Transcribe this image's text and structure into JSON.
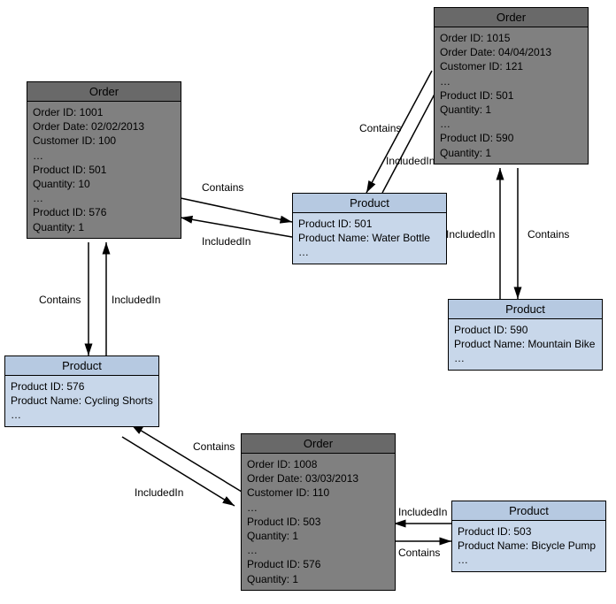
{
  "types": {
    "order_title": "Order",
    "product_title": "Product"
  },
  "labels": {
    "contains": "Contains",
    "includedIn": "IncludedIn"
  },
  "orders": {
    "o1001": {
      "lines": "Order ID: 1001\nOrder Date: 02/02/2013\nCustomer ID: 100\n…\nProduct ID: 501\nQuantity: 10\n…\nProduct ID: 576\nQuantity: 1"
    },
    "o1015": {
      "lines": "Order ID: 1015\nOrder Date: 04/04/2013\nCustomer ID: 121\n…\nProduct ID: 501\nQuantity: 1\n…\nProduct ID: 590\nQuantity: 1"
    },
    "o1008": {
      "lines": "Order ID: 1008\nOrder Date: 03/03/2013\nCustomer ID: 110\n…\nProduct ID: 503\nQuantity: 1\n…\nProduct ID: 576\nQuantity: 1"
    }
  },
  "products": {
    "p501": {
      "lines": "Product ID: 501\nProduct Name: Water Bottle\n…"
    },
    "p576": {
      "lines": "Product ID: 576\nProduct Name: Cycling Shorts\n…"
    },
    "p590": {
      "lines": "Product ID: 590\nProduct Name: Mountain Bike\n…"
    },
    "p503": {
      "lines": "Product ID: 503\nProduct Name: Bicycle Pump\n…"
    }
  },
  "chart_data": {
    "type": "table",
    "title": "Order–Product relationship graph",
    "nodes": [
      {
        "id": "o1001",
        "type": "Order",
        "order_id": 1001,
        "order_date": "02/02/2013",
        "customer_id": 100,
        "items": [
          {
            "product_id": 501,
            "quantity": 10
          },
          {
            "product_id": 576,
            "quantity": 1
          }
        ]
      },
      {
        "id": "o1015",
        "type": "Order",
        "order_id": 1015,
        "order_date": "04/04/2013",
        "customer_id": 121,
        "items": [
          {
            "product_id": 501,
            "quantity": 1
          },
          {
            "product_id": 590,
            "quantity": 1
          }
        ]
      },
      {
        "id": "o1008",
        "type": "Order",
        "order_id": 1008,
        "order_date": "03/03/2013",
        "customer_id": 110,
        "items": [
          {
            "product_id": 503,
            "quantity": 1
          },
          {
            "product_id": 576,
            "quantity": 1
          }
        ]
      },
      {
        "id": "p501",
        "type": "Product",
        "product_id": 501,
        "product_name": "Water Bottle"
      },
      {
        "id": "p576",
        "type": "Product",
        "product_id": 576,
        "product_name": "Cycling Shorts"
      },
      {
        "id": "p590",
        "type": "Product",
        "product_id": 590,
        "product_name": "Mountain Bike"
      },
      {
        "id": "p503",
        "type": "Product",
        "product_id": 503,
        "product_name": "Bicycle Pump"
      }
    ],
    "edges": [
      {
        "from": "o1001",
        "to": "p501",
        "label": "Contains"
      },
      {
        "from": "p501",
        "to": "o1001",
        "label": "IncludedIn"
      },
      {
        "from": "o1001",
        "to": "p576",
        "label": "Contains"
      },
      {
        "from": "p576",
        "to": "o1001",
        "label": "IncludedIn"
      },
      {
        "from": "o1015",
        "to": "p501",
        "label": "Contains"
      },
      {
        "from": "p501",
        "to": "o1015",
        "label": "IncludedIn"
      },
      {
        "from": "o1015",
        "to": "p590",
        "label": "Contains"
      },
      {
        "from": "p590",
        "to": "o1015",
        "label": "IncludedIn"
      },
      {
        "from": "o1008",
        "to": "p576",
        "label": "Contains"
      },
      {
        "from": "p576",
        "to": "o1008",
        "label": "IncludedIn"
      },
      {
        "from": "o1008",
        "to": "p503",
        "label": "Contains"
      },
      {
        "from": "p503",
        "to": "o1008",
        "label": "IncludedIn"
      }
    ]
  }
}
